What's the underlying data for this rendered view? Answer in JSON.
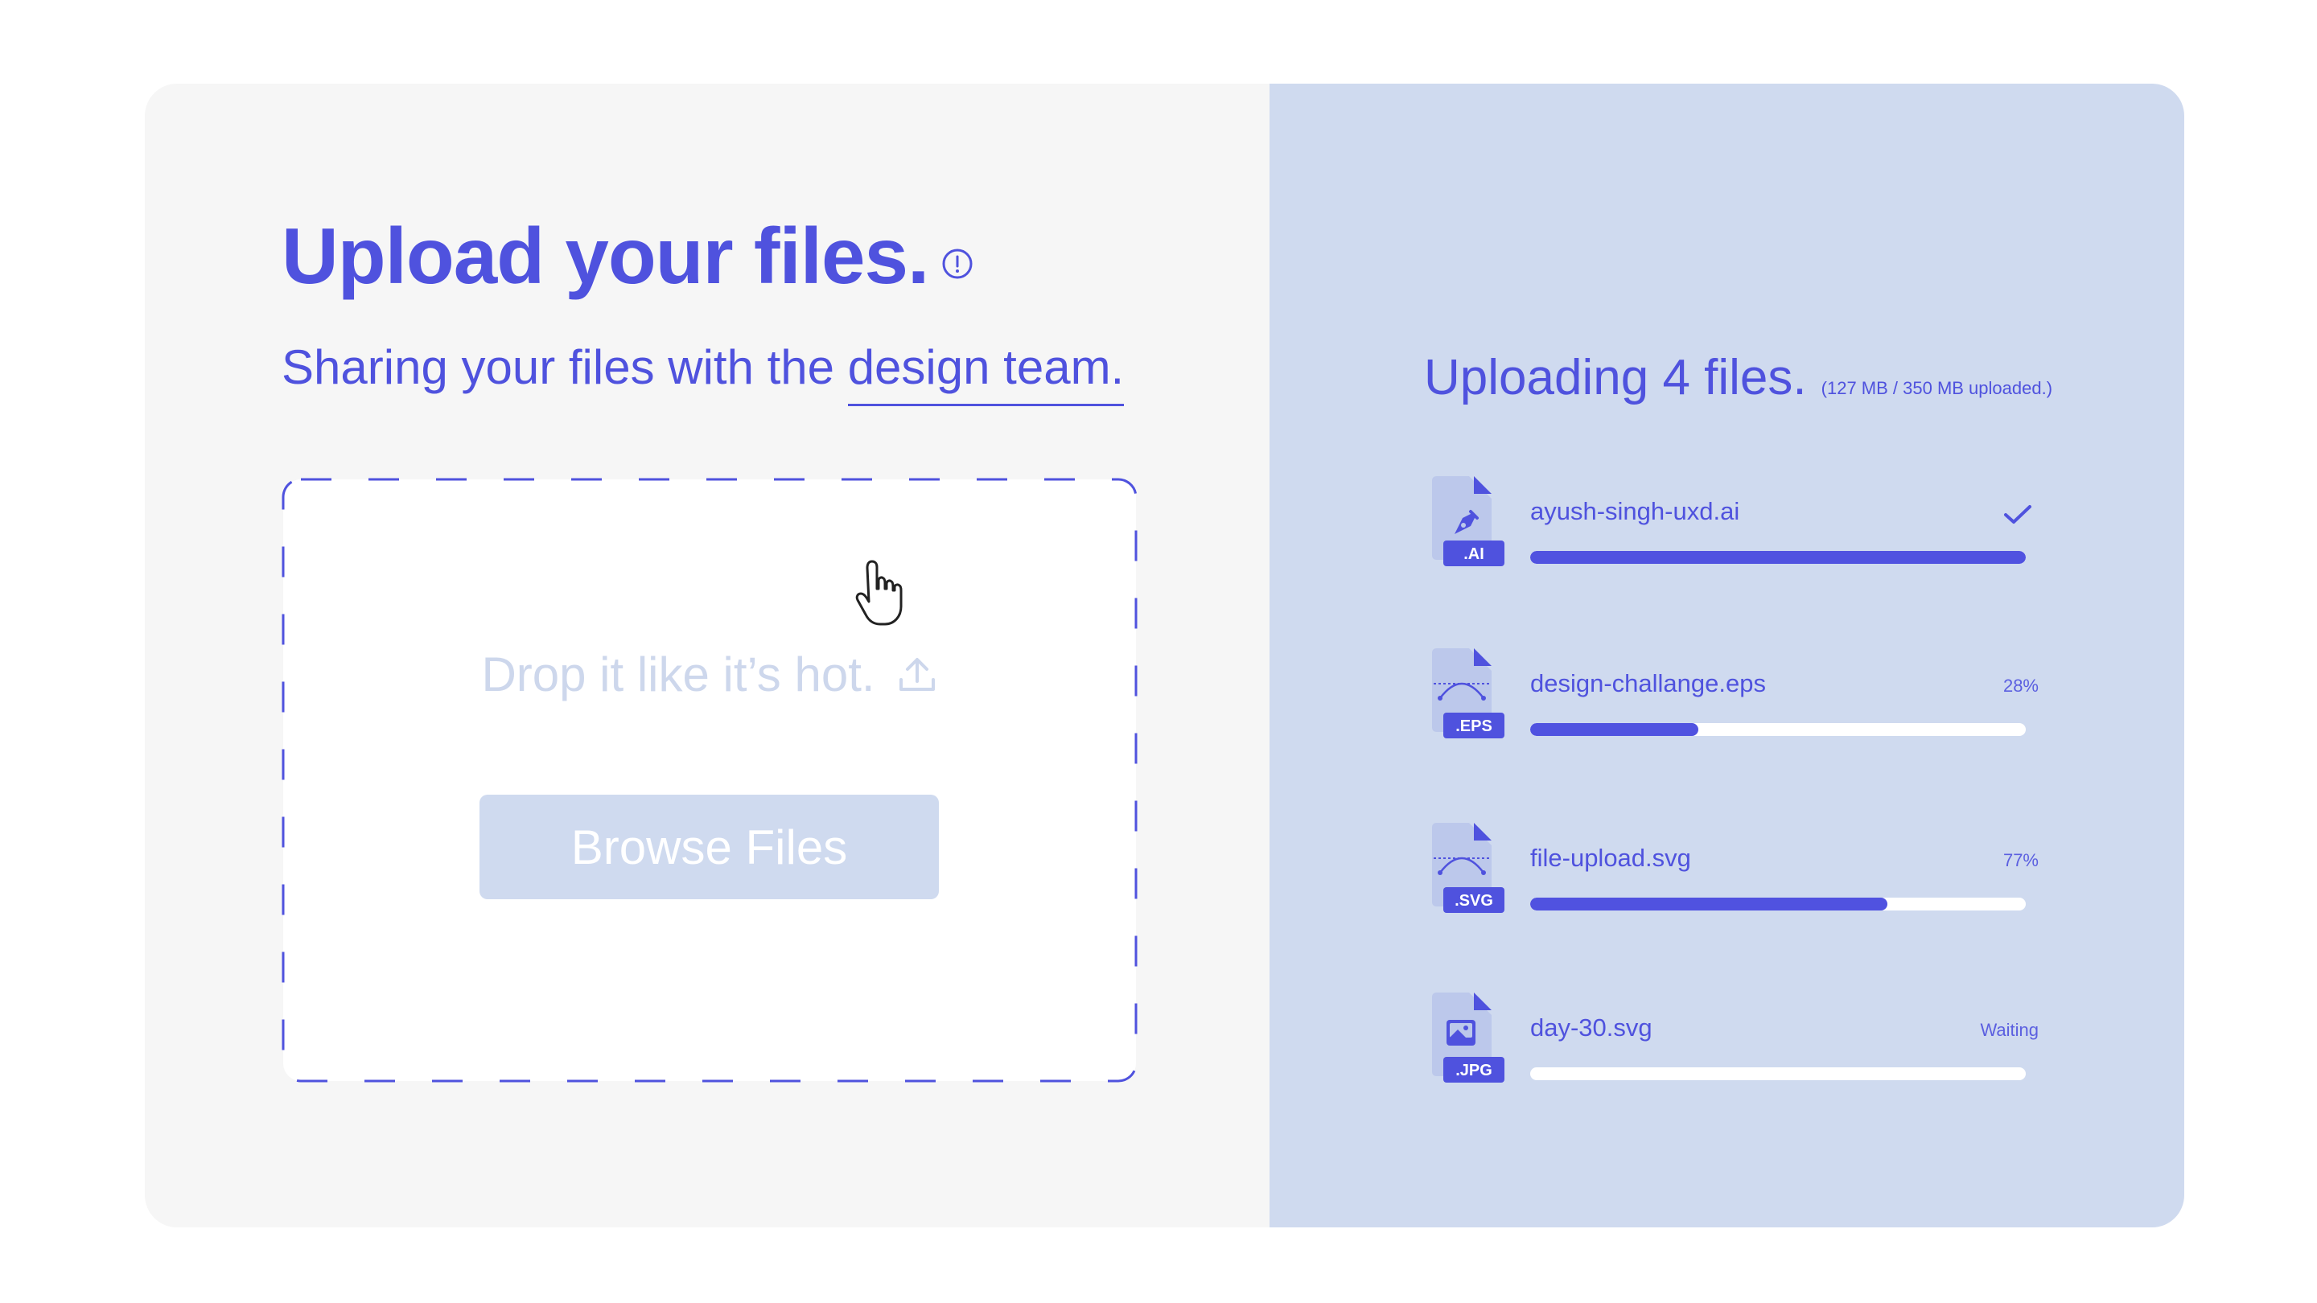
{
  "left_panel": {
    "title": "Upload your files.",
    "subtitle_prefix": "Sharing your files with the ",
    "subtitle_link": "design team.",
    "dropzone": {
      "drop_text": "Drop it like it’s hot.",
      "browse_label": "Browse Files"
    }
  },
  "right_panel": {
    "heading": "Uploading 4 files.",
    "summary": "(127 MB / 350 MB uploaded.)",
    "files": [
      {
        "ext": ".AI",
        "name": "ayush-singh-uxd.ai",
        "status": "",
        "complete": true,
        "progress": 1.0,
        "icon": "pen-nib-icon"
      },
      {
        "ext": ".EPS",
        "name": "design-challange.eps",
        "status": "28%",
        "complete": false,
        "progress": 0.34,
        "icon": "bezier-curve-icon"
      },
      {
        "ext": ".SVG",
        "name": "file-upload.svg",
        "status": "77%",
        "complete": false,
        "progress": 0.72,
        "icon": "bezier-curve-icon"
      },
      {
        "ext": ".JPG",
        "name": "day-30.svg",
        "status": "Waiting",
        "complete": false,
        "progress": 0.0,
        "icon": "image-icon"
      }
    ]
  },
  "colors": {
    "accent": "#4f52de",
    "left_bg": "#f6f6f6",
    "right_bg": "#cfdaef",
    "progress_fill": "#5052e0",
    "muted": "#cdd7ec"
  }
}
